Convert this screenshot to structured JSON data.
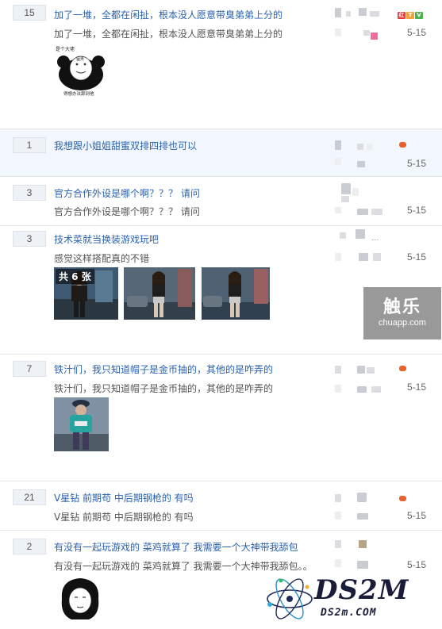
{
  "threads": [
    {
      "count": "15",
      "title": "加了一堆，全都在闲扯，根本没人愿意带臭弟弟上分的",
      "snippet": "加了一堆，全都在闲扯，根本没人愿意带臭弟弟上分的",
      "date": "5-15",
      "meme_text_top": "是个大佬",
      "meme_text_face": "猛男",
      "meme_text_bottom": "得想办法舔到他"
    },
    {
      "count": "1",
      "title": "我想跟小姐姐甜蜜双排四排也可以",
      "snippet": "",
      "date": "5-15"
    },
    {
      "count": "3",
      "title": "官方合作外设是哪个啊？？？ 请问",
      "snippet": "官方合作外设是哪个啊？？？ 请问",
      "date": "5-15"
    },
    {
      "count": "3",
      "title": "技术菜就当换装游戏玩吧",
      "snippet": "感觉这样搭配真的不错",
      "date": "5-15",
      "image_count_label": "共 6 张",
      "ellipsis": "..."
    },
    {
      "count": "7",
      "title": "铁汁们，我只知道帽子是金币抽的，其他的是咋弄的",
      "snippet": "铁汁们，我只知道帽子是金币抽的，其他的是咋弄的",
      "date": "5-15"
    },
    {
      "count": "21",
      "title": "V星钻 前期苟 中后期钢枪的 有吗",
      "snippet": "V星钻 前期苟 中后期钢枪的 有吗",
      "date": "5-15"
    },
    {
      "count": "2",
      "title": "有没有一起玩游戏的 菜鸡就算了 我需要一个大神带我舔包",
      "snippet": "有没有一起玩游戏的 菜鸡就算了 我需要一个大神带我舔包。。",
      "date": "5-15"
    }
  ],
  "badges": {
    "b1": "红",
    "b2": "T",
    "b3": "V"
  },
  "watermark": {
    "title": "触乐",
    "url": "chuapp.com"
  },
  "logo": {
    "text": "DS2M",
    "url": "DS2m.COM"
  }
}
